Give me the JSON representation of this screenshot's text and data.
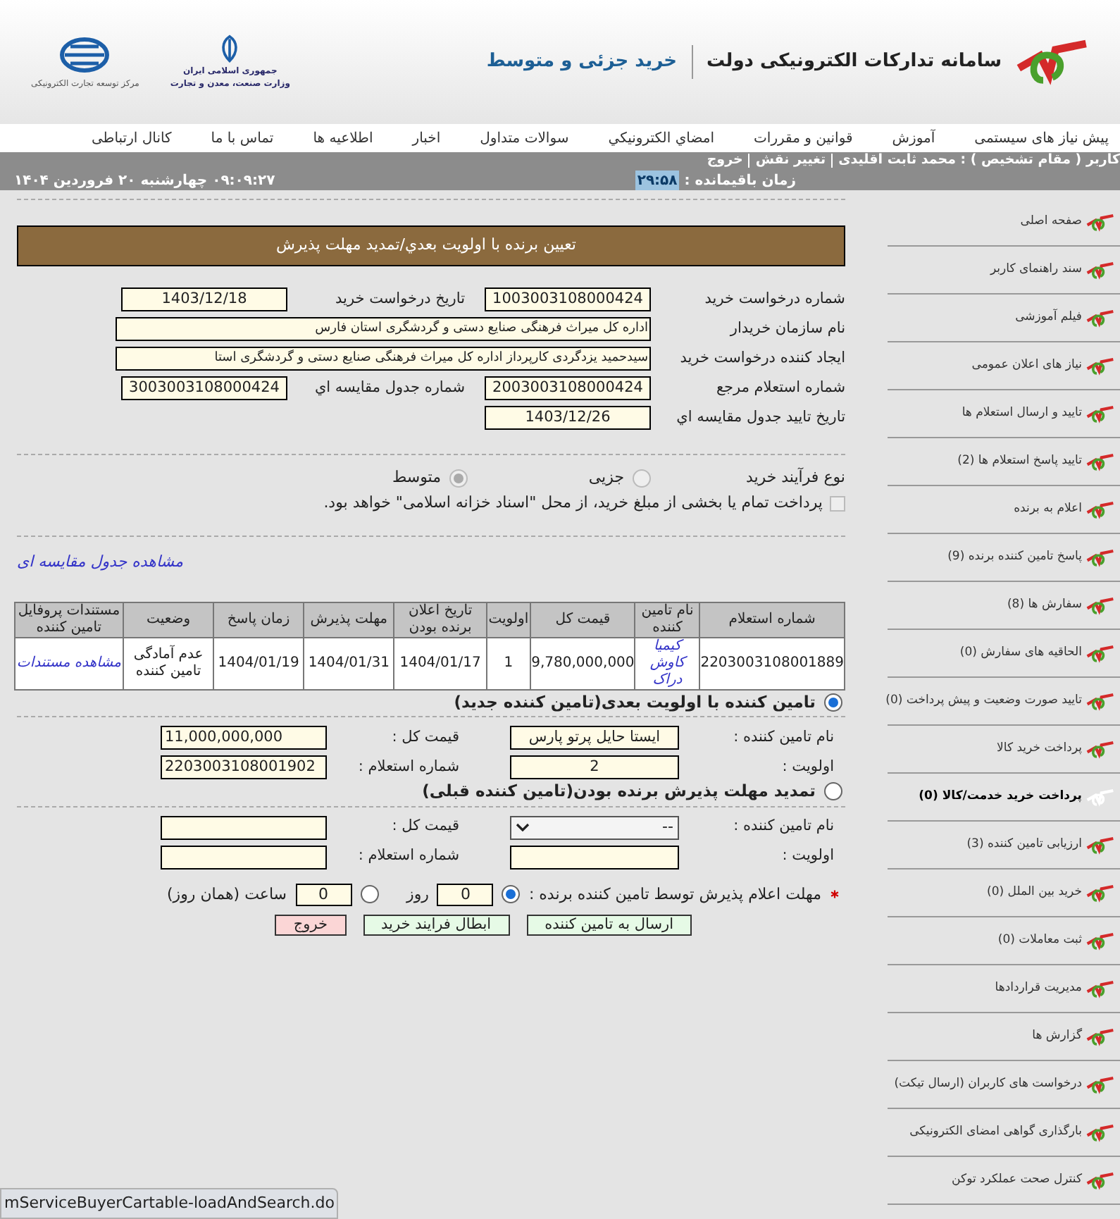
{
  "header": {
    "title": "سامانه تدارکات الکترونیکی دولت",
    "subtitle": "خرید جزئی و متوسط",
    "ministry_lines": [
      "جمهوری اسلامی ایران",
      "وزارت صنعت، معدن و تجارت"
    ],
    "center_caption": "مرکز توسعه تجارت الکترونیکی"
  },
  "nav": [
    "پیش نیاز های سیستمی",
    "آموزش",
    "قوانین و مقررات",
    "امضاي الكترونيكي",
    "سوالات متداول",
    "اخبار",
    "اطلاعیه ها",
    "تماس با ما",
    "کانال ارتباطی"
  ],
  "user_bar": {
    "user": "کاربر ( مقام تشخیص ) : محمد ثابت اقلیدی",
    "change_role": "تغییر نقش",
    "logout": "خروج",
    "remaining_label": "زمان باقیمانده :",
    "remaining": "۲۹:۵۸",
    "datetime": "۰۹:۰۹:۲۷  چهارشنبه ۲۰ فروردین ۱۴۰۴"
  },
  "page_title": "تعیین برنده با اولویت بعدي/تمدید مهلت پذیرش",
  "info_rows": [
    [
      {
        "label": "شماره درخواست خرید",
        "value": "1003003108000424",
        "kind": "short"
      },
      {
        "label": "تاریخ درخواست خرید",
        "value": "1403/12/18",
        "kind": "short"
      }
    ],
    [
      {
        "label": "نام سازمان خریدار",
        "value": "اداره کل میراث فرهنگی  صنایع دستی و گردشگری استان فارس",
        "kind": "wide"
      }
    ],
    [
      {
        "label": "ایجاد کننده درخواست خرید",
        "value": "سیدحمید یزدگردی کارپرداز اداره کل میراث فرهنگی  صنایع دستی و گردشگری استا",
        "kind": "wide"
      }
    ],
    [
      {
        "label": "شماره استعلام مرجع",
        "value": "2003003108000424",
        "kind": "short"
      },
      {
        "label": "شماره جدول مقایسه اي",
        "value": "3003003108000424",
        "kind": "short"
      }
    ],
    [
      {
        "label": "تاریخ تایید جدول مقایسه اي",
        "value": "1403/12/26",
        "kind": "short"
      }
    ]
  ],
  "process_type": {
    "label": "نوع فرآیند خرید",
    "options": [
      {
        "label": "جزیی",
        "selected": false,
        "disabled": true
      },
      {
        "label": "متوسط",
        "selected": true,
        "disabled": true
      }
    ]
  },
  "treasury": {
    "label": "پرداخت تمام یا بخشی از مبلغ خرید، از محل \"اسناد خزانه اسلامی\" خواهد بود.",
    "checked": false,
    "disabled": true
  },
  "comparison_link": "مشاهده جدول مقایسه ای",
  "table": {
    "columns": [
      "شماره استعلام",
      "نام تامین کننده",
      "قیمت کل",
      "اولویت",
      "تاریخ اعلان برنده بودن",
      "مهلت پذیرش",
      "زمان پاسخ",
      "وضعیت",
      "مستندات پروفایل تامین کننده"
    ],
    "rows": [
      {
        "cells": [
          {
            "text": "2203003108001889",
            "kind": "text"
          },
          {
            "text": "کیمیا کاوش دراک",
            "kind": "link"
          },
          {
            "text": "9,780,000,000",
            "kind": "text"
          },
          {
            "text": "1",
            "kind": "text"
          },
          {
            "text": "1404/01/17",
            "kind": "text"
          },
          {
            "text": "1404/01/31",
            "kind": "text"
          },
          {
            "text": "1404/01/19",
            "kind": "text"
          },
          {
            "text": "عدم آمادگی تامین کننده",
            "kind": "text"
          },
          {
            "text": "مشاهده مستندات",
            "kind": "link"
          }
        ]
      }
    ]
  },
  "options": [
    {
      "title": "تامین کننده با اولویت بعدی(تامین کننده جدید)",
      "selected": true,
      "rows": [
        [
          {
            "label": "نام تامین کننده :",
            "value": "ایستا حایل پرتو پارس",
            "kind": "input"
          },
          {
            "label": "قیمت کل :",
            "value": "11,000,000,000",
            "kind": "input"
          }
        ],
        [
          {
            "label": "اولویت :",
            "value": "2",
            "kind": "input"
          },
          {
            "label": "شماره استعلام :",
            "value": "2203003108001902",
            "kind": "input"
          }
        ]
      ]
    },
    {
      "title": "تمدید مهلت پذیرش برنده بودن(تامین کننده قبلی)",
      "selected": false,
      "rows": [
        [
          {
            "label": "نام تامین کننده :",
            "value": "--",
            "kind": "select"
          },
          {
            "label": "قیمت کل :",
            "kind": "input"
          }
        ],
        [
          {
            "label": "اولویت :",
            "kind": "input"
          },
          {
            "label": "شماره استعلام :",
            "kind": "input"
          }
        ]
      ]
    }
  ],
  "deadline": {
    "label": "مهلت اعلام پذیرش توسط تامین کننده برنده :",
    "required": true,
    "choices": [
      {
        "value": "0",
        "unit": "روز",
        "selected": true
      },
      {
        "value": "0",
        "unit": "ساعت (همان روز)",
        "selected": false
      }
    ]
  },
  "buttons": [
    {
      "label": "ارسال به تامین کننده",
      "kind": "action"
    },
    {
      "label": "ابطال فرایند خرید",
      "kind": "action"
    },
    {
      "label": "خروج",
      "kind": "exit"
    }
  ],
  "sidebar": [
    {
      "label": "صفحه اصلی",
      "selected": false
    },
    {
      "label": "سند راهنمای کاربر",
      "selected": false
    },
    {
      "label": "فیلم آموزشی",
      "selected": false
    },
    {
      "label": "نیاز های اعلان عمومی",
      "selected": false
    },
    {
      "label": "تایید و ارسال استعلام ها",
      "selected": false
    },
    {
      "label": "تایید پاسخ استعلام ها (2)",
      "selected": false
    },
    {
      "label": "اعلام به برنده",
      "selected": false
    },
    {
      "label": "پاسخ تامین کننده برنده (9)",
      "selected": false
    },
    {
      "label": "سفارش ها (8)",
      "selected": false
    },
    {
      "label": "الحاقیه های سفارش (0)",
      "selected": false
    },
    {
      "label": "تایید صورت وضعیت و پیش پرداخت (0)",
      "selected": false
    },
    {
      "label": "پرداخت خرید کالا",
      "selected": false
    },
    {
      "label": "پرداخت خرید خدمت/کالا (0)",
      "selected": true
    },
    {
      "label": "ارزیابی تامین کننده (3)",
      "selected": false
    },
    {
      "label": "خرید بین الملل  (0)",
      "selected": false
    },
    {
      "label": "ثبت معاملات  (0)",
      "selected": false
    },
    {
      "label": "مدیریت قراردادها",
      "selected": false
    },
    {
      "label": "گزارش ها",
      "selected": false
    },
    {
      "label": "درخواست های کاربران (ارسال تیکت)",
      "selected": false
    },
    {
      "label": "بارگذاری گواهی امضای الکترونیکی",
      "selected": false
    },
    {
      "label": "کنترل صحت عملکرد توکن",
      "selected": false
    }
  ],
  "status_url": "mServiceBuyerCartable-loadAndSearch.do"
}
